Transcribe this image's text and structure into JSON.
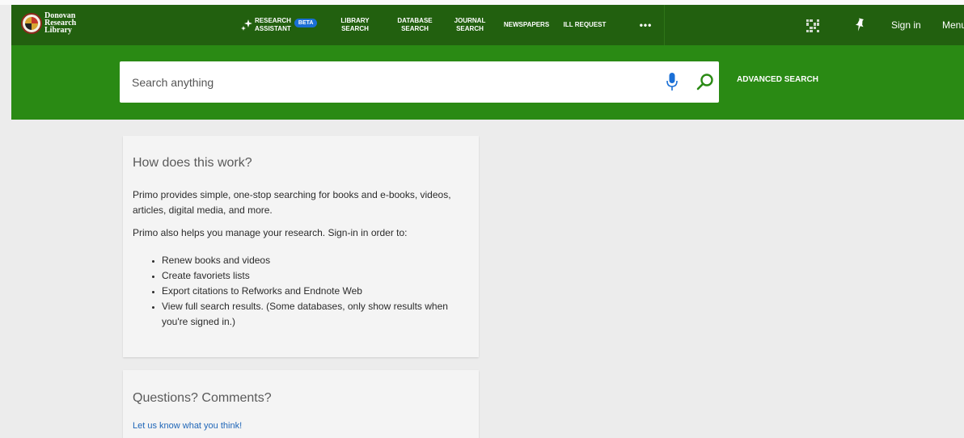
{
  "logo": {
    "line1": "Donovan",
    "line2": "Research",
    "line3": "Library"
  },
  "nav": {
    "research_line1": "RESEARCH",
    "research_line2": "ASSISTANT",
    "beta": "BETA",
    "library_line1": "LIBRARY",
    "library_line2": "SEARCH",
    "database_line1": "DATABASE",
    "database_line2": "SEARCH",
    "journal_line1": "JOURNAL",
    "journal_line2": "SEARCH",
    "newspapers": "NEWSPAPERS",
    "ill": "ILL REQUEST",
    "more": "•••",
    "sign_in": "Sign in",
    "menu": "Menu"
  },
  "search": {
    "placeholder": "Search anything",
    "advanced": "ADVANCED SEARCH"
  },
  "card1": {
    "title": "How does this work?",
    "para1": "Primo provides simple, one-stop searching for books and e-books, videos, articles, digital media, and more.",
    "para2": "Primo also helps you manage your research. Sign-in in order to:",
    "items": [
      "Renew books and videos",
      "Create favoriets lists",
      "Export citations to Refworks and Endnote Web",
      "View full search results. (Some databases, only show results when you're signed in.)"
    ]
  },
  "card2": {
    "title": "Questions? Comments?",
    "link": "Let us know what you think!"
  },
  "colors": {
    "top_bar": "#22600f",
    "search_band": "#2a8a14",
    "accent_icon": "#1a6fd6",
    "beta_badge": "#1a6fd6",
    "link": "#1f66b8",
    "background": "#ececec"
  },
  "icons": [
    "university-seal-icon",
    "sparkle-icon",
    "qr-code-icon",
    "pin-icon",
    "microphone-icon",
    "search-icon"
  ]
}
